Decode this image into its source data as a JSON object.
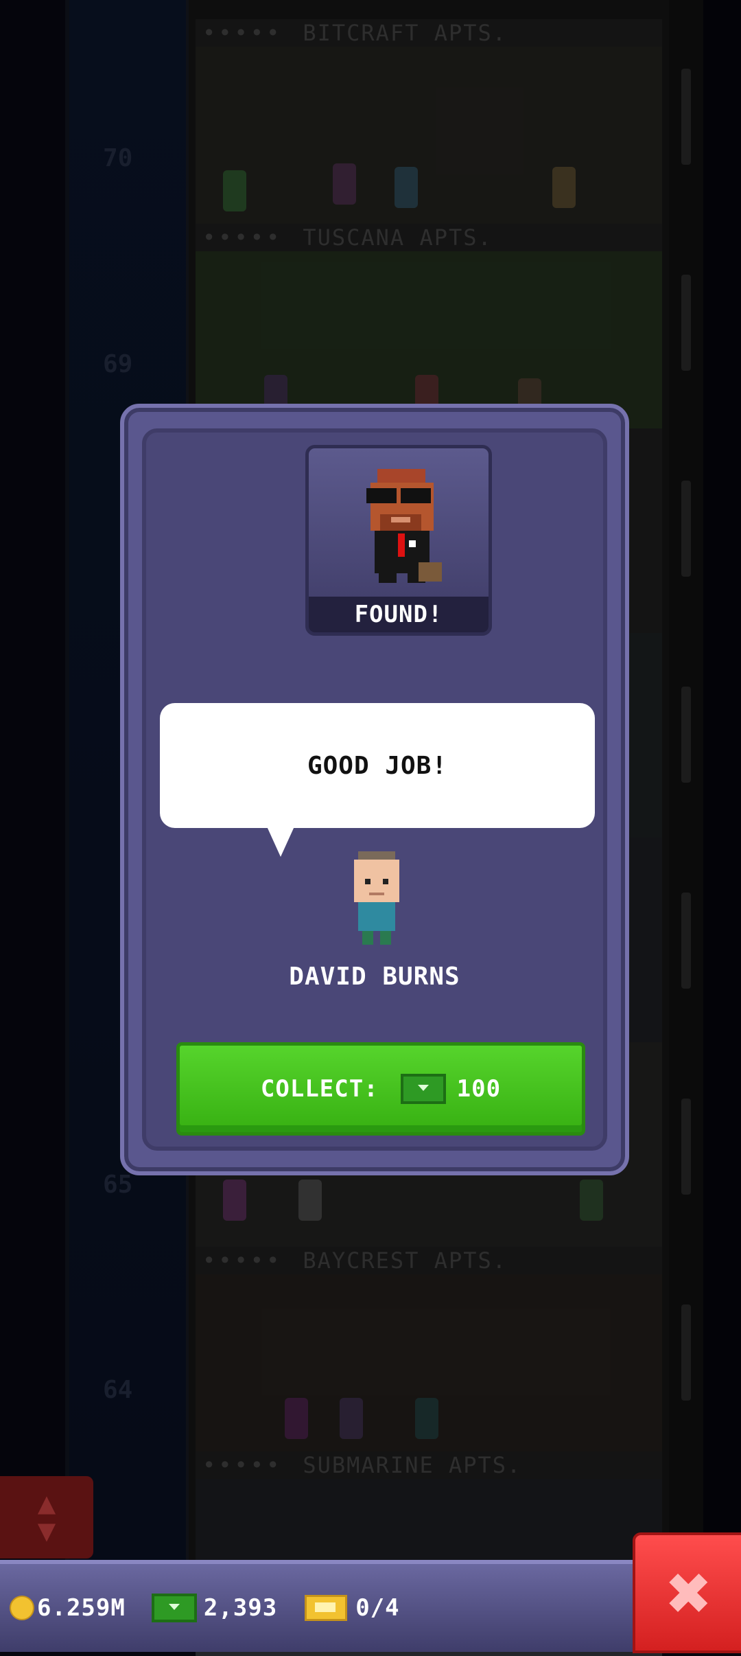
{
  "tower": {
    "floors": [
      {
        "number": "70",
        "name": "BITCRAFT APTS."
      },
      {
        "number": "69",
        "name": "TUSCANA APTS."
      },
      {
        "number": "65",
        "name": ""
      },
      {
        "number": "64",
        "name": "BAYCREST APTS."
      },
      {
        "number": "",
        "name": "SUBMARINE APTS."
      }
    ],
    "rating_dots": "•••••"
  },
  "modal": {
    "portrait_label": "FOUND!",
    "speech": "GOOD JOB!",
    "npc_name": "DAVID BURNS",
    "collect": {
      "label": "COLLECT:",
      "amount": "100",
      "icon": "bux-icon"
    }
  },
  "status_bar": {
    "coins": "6.259M",
    "bux": "2,393",
    "tickets": "0/4",
    "close_icon": "close-icon"
  },
  "colors": {
    "collect_green": "#46c41c",
    "close_red": "#e52a2a",
    "modal_purple": "#4a4777"
  }
}
